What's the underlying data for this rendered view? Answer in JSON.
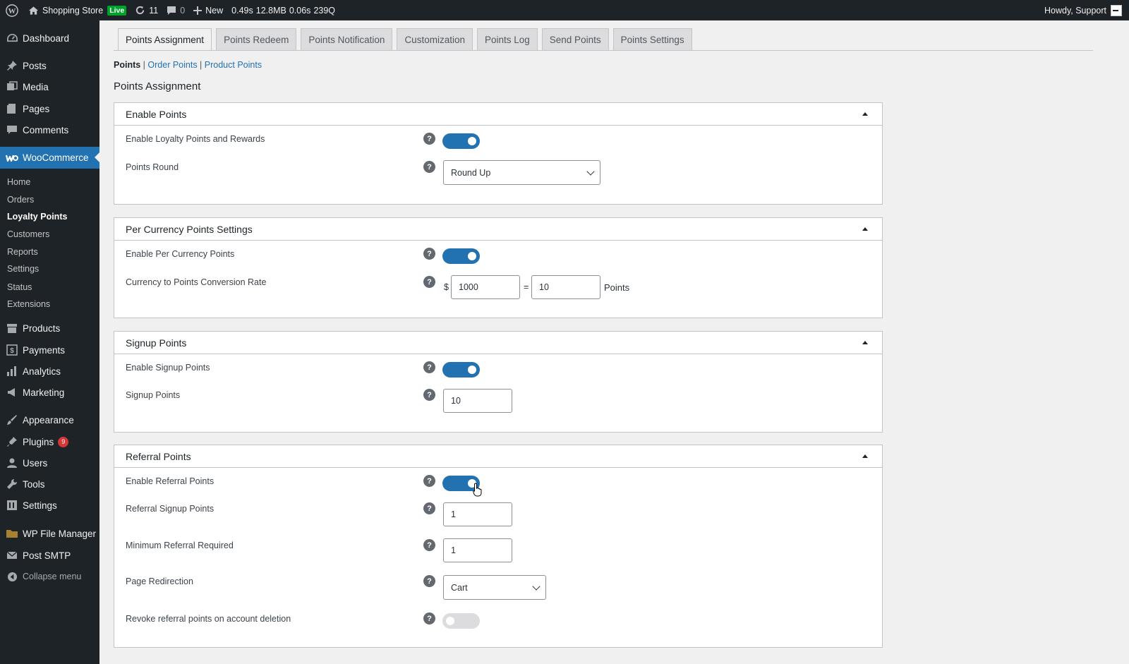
{
  "adminbar": {
    "site_name": "Shopping Store",
    "live_badge": "Live",
    "updates_count": "11",
    "comments_count": "0",
    "new_label": "New",
    "perf_time": "0.49s",
    "perf_memory": "12.8MB",
    "perf_db_time": "0.06s",
    "perf_queries": "239Q",
    "howdy": "Howdy, Support"
  },
  "sidebar": {
    "dashboard": "Dashboard",
    "posts": "Posts",
    "media": "Media",
    "pages": "Pages",
    "comments": "Comments",
    "woocommerce": "WooCommerce",
    "submenu": {
      "home": "Home",
      "orders": "Orders",
      "loyalty_points": "Loyalty Points",
      "customers": "Customers",
      "reports": "Reports",
      "settings": "Settings",
      "status": "Status",
      "extensions": "Extensions"
    },
    "products": "Products",
    "payments": "Payments",
    "analytics": "Analytics",
    "marketing": "Marketing",
    "appearance": "Appearance",
    "plugins": "Plugins",
    "plugins_badge": "9",
    "users": "Users",
    "tools": "Tools",
    "settings": "Settings",
    "wp_file_manager": "WP File Manager",
    "post_smtp": "Post SMTP",
    "collapse": "Collapse menu"
  },
  "tabs": {
    "assignment": "Points Assignment",
    "redeem": "Points Redeem",
    "notification": "Points Notification",
    "customization": "Customization",
    "log": "Points Log",
    "send": "Send Points",
    "settings": "Points Settings"
  },
  "subnav": {
    "points": "Points",
    "sep1": " | ",
    "order_points": "Order Points",
    "sep2": " | ",
    "product_points": "Product Points"
  },
  "page_title": "Points Assignment",
  "panels": {
    "enable_points": {
      "title": "Enable Points",
      "enable_label": "Enable Loyalty Points and Rewards",
      "round_label": "Points Round",
      "round_value": "Round Up"
    },
    "per_currency": {
      "title": "Per Currency Points Settings",
      "enable_label": "Enable Per Currency Points",
      "rate_label": "Currency to Points Conversion Rate",
      "currency_symbol": "$",
      "currency_value": "1000",
      "equals": "=",
      "points_value": "10",
      "points_unit": "Points"
    },
    "signup": {
      "title": "Signup Points",
      "enable_label": "Enable Signup Points",
      "points_label": "Signup Points",
      "points_value": "10"
    },
    "referral": {
      "title": "Referral Points",
      "enable_label": "Enable Referral Points",
      "signup_label": "Referral Signup Points",
      "signup_value": "1",
      "min_label": "Minimum Referral Required",
      "min_value": "1",
      "redirect_label": "Page Redirection",
      "redirect_value": "Cart",
      "revoke_label": "Revoke referral points on account deletion"
    }
  },
  "help_glyph": "?",
  "colors": {
    "admin_dark": "#1d2327",
    "accent": "#2271b1",
    "background": "#f0f0f1",
    "badge_red": "#d63638"
  }
}
